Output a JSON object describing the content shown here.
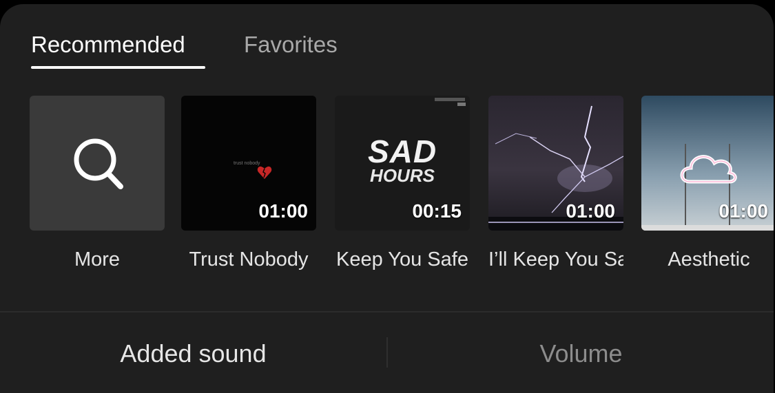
{
  "tabs": [
    {
      "label": "Recommended",
      "active": true
    },
    {
      "label": "Favorites",
      "active": false
    }
  ],
  "cards": [
    {
      "label": "More",
      "duration": null,
      "icon": "search-icon"
    },
    {
      "label": "Trust Nobody",
      "duration": "01:00",
      "thumb_text": "trust nobody",
      "thumb_icon": "broken-heart-icon"
    },
    {
      "label": "Keep You Safe",
      "duration": "00:15",
      "thumb_text_1": "SAD",
      "thumb_text_2": "HOURS"
    },
    {
      "label": "I’ll Keep You Safe",
      "duration": "01:00",
      "thumb_theme": "lightning"
    },
    {
      "label": "Aesthetic",
      "duration": "01:00",
      "thumb_theme": "neon-cloud"
    }
  ],
  "bottom": {
    "added_sound": "Added sound",
    "volume": "Volume"
  },
  "colors": {
    "panel": "#1f1f1f",
    "active_text": "#ffffff",
    "inactive_text": "#a9a9a9"
  }
}
